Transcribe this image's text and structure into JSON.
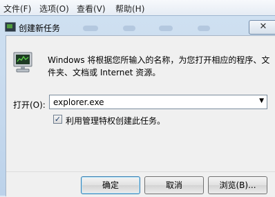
{
  "menubar": {
    "items": [
      "文件(F)",
      "选项(O)",
      "查看(V)",
      "帮助(H)"
    ]
  },
  "dialog": {
    "title": "创建新任务",
    "description": "Windows 将根据您所输入的名称，为您打开相应的程序、文件夹、文档或 Internet 资源。",
    "open_label": "打开(O):",
    "open_value": "explorer.exe",
    "admin_checkbox": {
      "label": "利用管理特权创建此任务。",
      "checked": true
    },
    "buttons": {
      "ok": "确定",
      "cancel": "取消",
      "browse": "浏览(B)..."
    }
  }
}
